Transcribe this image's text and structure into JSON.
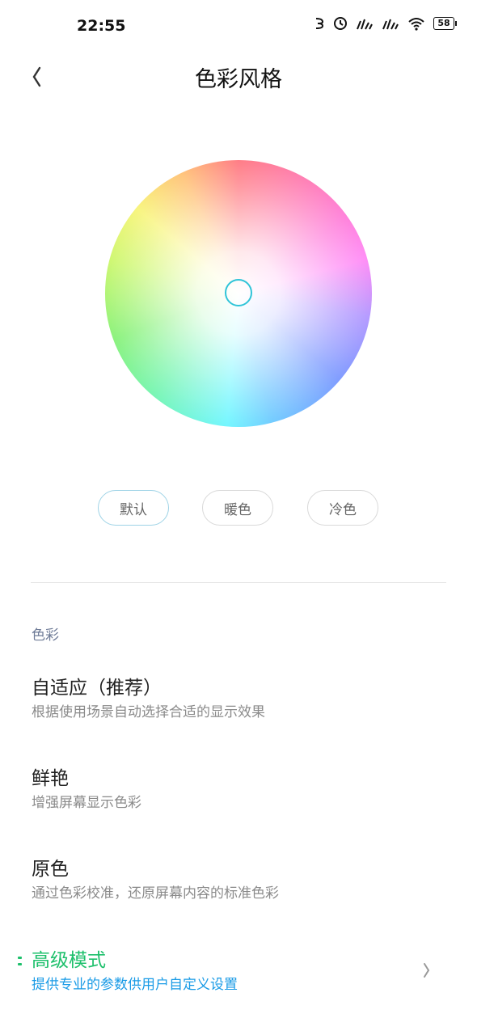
{
  "status_bar": {
    "time": "22:55",
    "icons": [
      "data-saver-icon",
      "alarm-icon",
      "signal-icon",
      "signal-icon",
      "wifi-icon"
    ],
    "battery": "58"
  },
  "header": {
    "back_icon": "back-icon",
    "title": "色彩风格"
  },
  "color_wheel": {
    "picker_color": "#2fc4d8"
  },
  "presets": {
    "default_label": "默认",
    "warm_label": "暖色",
    "cool_label": "冷色",
    "selected": "默认"
  },
  "section": {
    "title": "色彩"
  },
  "options": [
    {
      "title": "自适应（推荐）",
      "desc": "根据使用场景自动选择合适的显示效果"
    },
    {
      "title": "鲜艳",
      "desc": "增强屏幕显示色彩"
    },
    {
      "title": "原色",
      "desc": "通过色彩校准，还原屏幕内容的标准色彩"
    }
  ],
  "advanced": {
    "title": "高级模式",
    "desc": "提供专业的参数供用户自定义设置",
    "title_color": "#1ec06c",
    "desc_color": "#1a9be6"
  }
}
